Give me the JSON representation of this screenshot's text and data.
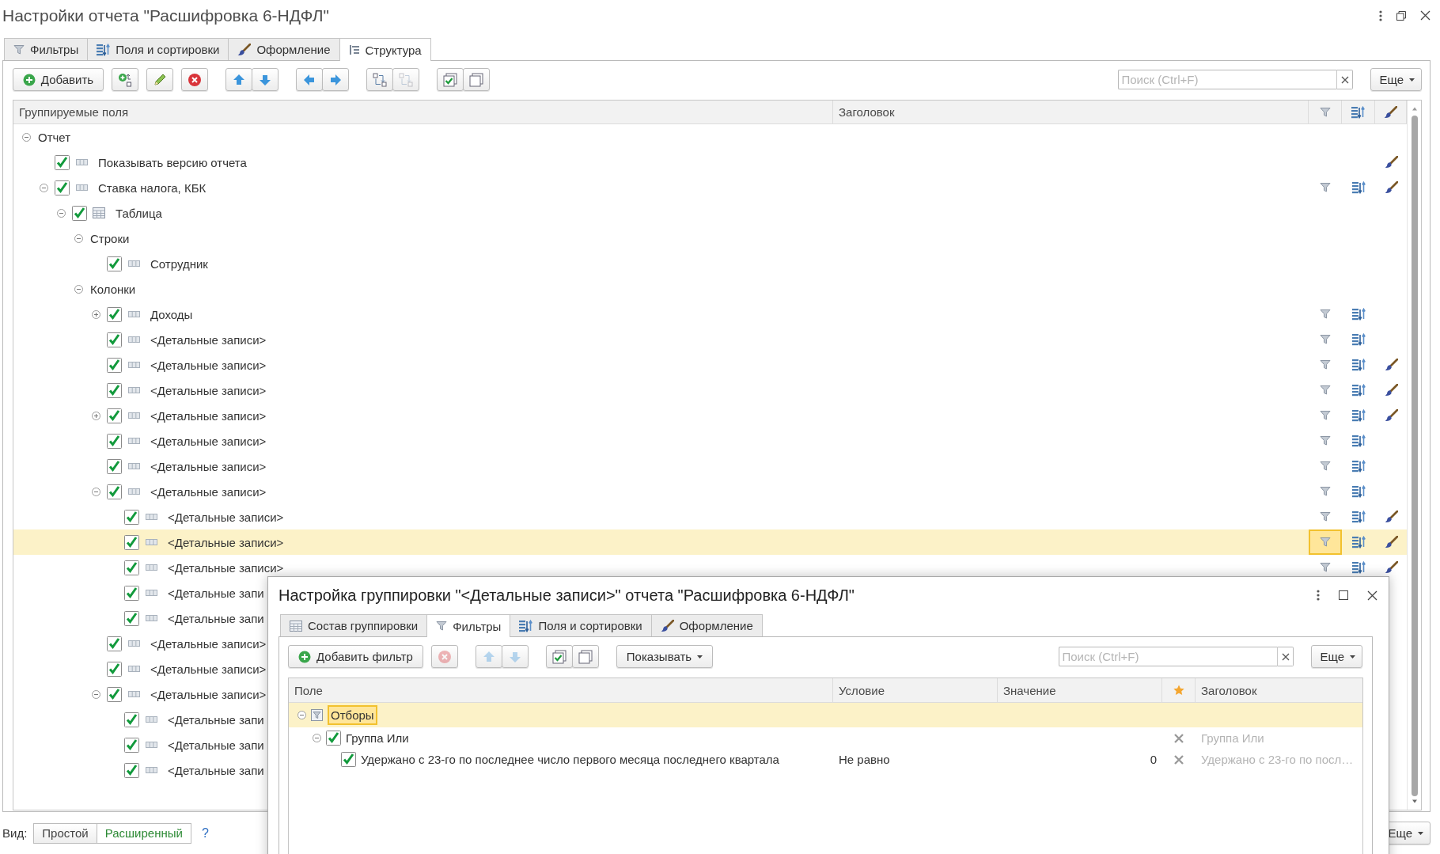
{
  "window": {
    "title": "Настройки отчета \"Расшифровка 6-НДФЛ\""
  },
  "tabs": [
    {
      "label": "Фильтры",
      "kind": "filter",
      "selected": false
    },
    {
      "label": "Поля и сортировки",
      "kind": "sort",
      "selected": false
    },
    {
      "label": "Оформление",
      "kind": "brush",
      "selected": false
    },
    {
      "label": "Структура",
      "kind": "tree",
      "selected": true
    }
  ],
  "toolbar": {
    "add_button": "Добавить",
    "button_groups": [
      {
        "buttons": [
          {
            "kind": "add-group",
            "disabled": false
          }
        ]
      },
      {
        "buttons": [
          {
            "kind": "edit",
            "disabled": false
          }
        ]
      },
      {
        "buttons": [
          {
            "kind": "delete",
            "disabled": false
          }
        ]
      },
      {
        "buttons": [
          {
            "kind": "up",
            "disabled": false
          },
          {
            "kind": "down",
            "disabled": false
          }
        ]
      },
      {
        "buttons": [
          {
            "kind": "left",
            "disabled": false
          },
          {
            "kind": "right",
            "disabled": false
          }
        ]
      },
      {
        "buttons": [
          {
            "kind": "swap",
            "disabled": false
          },
          {
            "kind": "swap",
            "disabled": true
          }
        ]
      },
      {
        "buttons": [
          {
            "kind": "check-all",
            "disabled": false
          },
          {
            "kind": "uncheck-all",
            "disabled": false
          }
        ]
      }
    ],
    "search": {
      "placeholder": "Поиск (Ctrl+F)"
    },
    "more_button": "Еще"
  },
  "tree": {
    "columns": [
      "Группируемые поля",
      "Заголовок"
    ],
    "rows": [
      {
        "label": "Отчет",
        "kind": "section",
        "expanded": true,
        "selected": false,
        "children": [
          {
            "label": "Показывать версию отчета",
            "kind": "field",
            "checked": true,
            "selected": false,
            "style": true
          },
          {
            "label": "Ставка налога, КБК",
            "kind": "field",
            "checked": true,
            "expanded": true,
            "selected": false,
            "filter": true,
            "sort": true,
            "style": true,
            "children": [
              {
                "label": "Таблица",
                "kind": "table",
                "checked": true,
                "expanded": true,
                "selected": false,
                "children": [
                  {
                    "label": "Строки",
                    "kind": "section",
                    "expanded": true,
                    "selected": false,
                    "children": [
                      {
                        "label": "Сотрудник",
                        "kind": "field",
                        "checked": true,
                        "selected": false
                      }
                    ]
                  },
                  {
                    "label": "Колонки",
                    "kind": "section",
                    "expanded": true,
                    "selected": false,
                    "children": [
                      {
                        "label": "Доходы",
                        "kind": "field",
                        "checked": true,
                        "expanded": false,
                        "selected": false,
                        "filter": true,
                        "sort": true
                      },
                      {
                        "label": "<Детальные записи>",
                        "kind": "field",
                        "checked": true,
                        "selected": false,
                        "filter": true,
                        "sort": true
                      },
                      {
                        "label": "<Детальные записи>",
                        "kind": "field",
                        "checked": true,
                        "selected": false,
                        "filter": true,
                        "sort": true,
                        "style": true
                      },
                      {
                        "label": "<Детальные записи>",
                        "kind": "field",
                        "checked": true,
                        "selected": false,
                        "filter": true,
                        "sort": true,
                        "style": true
                      },
                      {
                        "label": "<Детальные записи>",
                        "kind": "field",
                        "checked": true,
                        "expanded": false,
                        "selected": false,
                        "filter": true,
                        "sort": true,
                        "style": true
                      },
                      {
                        "label": "<Детальные записи>",
                        "kind": "field",
                        "checked": true,
                        "selected": false,
                        "filter": true,
                        "sort": true
                      },
                      {
                        "label": "<Детальные записи>",
                        "kind": "field",
                        "checked": true,
                        "selected": false,
                        "filter": true,
                        "sort": true
                      },
                      {
                        "label": "<Детальные записи>",
                        "kind": "field",
                        "checked": true,
                        "expanded": true,
                        "selected": false,
                        "filter": true,
                        "sort": true,
                        "children": [
                          {
                            "label": "<Детальные записи>",
                            "kind": "field",
                            "checked": true,
                            "selected": false,
                            "filter": true,
                            "sort": true,
                            "style": true
                          },
                          {
                            "label": "<Детальные записи>",
                            "kind": "field",
                            "checked": true,
                            "selected": true,
                            "filter": true,
                            "sort": true,
                            "style": true
                          },
                          {
                            "label": "<Детальные записи>",
                            "kind": "field",
                            "checked": true,
                            "selected": false,
                            "filter": true,
                            "sort": true,
                            "style": true
                          },
                          {
                            "label": "<Детальные запи",
                            "kind": "field",
                            "checked": true,
                            "selected": false
                          },
                          {
                            "label": "<Детальные запи",
                            "kind": "field",
                            "checked": true,
                            "selected": false
                          }
                        ]
                      },
                      {
                        "label": "<Детальные записи>",
                        "kind": "field",
                        "checked": true,
                        "selected": false
                      },
                      {
                        "label": "<Детальные записи>",
                        "kind": "field",
                        "checked": true,
                        "selected": false
                      },
                      {
                        "label": "<Детальные записи>",
                        "kind": "field",
                        "checked": true,
                        "expanded": true,
                        "selected": false,
                        "children": [
                          {
                            "label": "<Детальные запи",
                            "kind": "field",
                            "checked": true,
                            "selected": false
                          },
                          {
                            "label": "<Детальные запи",
                            "kind": "field",
                            "checked": true,
                            "selected": false
                          },
                          {
                            "label": "<Детальные запи",
                            "kind": "field",
                            "checked": true,
                            "selected": false
                          }
                        ]
                      }
                    ]
                  }
                ]
              }
            ]
          }
        ]
      }
    ]
  },
  "view_switch": {
    "label": "Вид:",
    "options": [
      {
        "label": "Простой",
        "selected": false
      },
      {
        "label": "Расширенный",
        "selected": true
      }
    ],
    "help": "?"
  },
  "bottom_more_button": "Еще",
  "dialog": {
    "title": "Настройка группировки \"<Детальные записи>\" отчета \"Расшифровка 6-НДФЛ\"",
    "tabs": [
      {
        "label": "Состав группировки",
        "kind": "table",
        "selected": false
      },
      {
        "label": "Фильтры",
        "kind": "filter",
        "selected": true
      },
      {
        "label": "Поля и сортировки",
        "kind": "sort",
        "selected": false
      },
      {
        "label": "Оформление",
        "kind": "brush",
        "selected": false
      }
    ],
    "toolbar": {
      "add_button": "Добавить фильтр",
      "button_groups": [
        {
          "buttons": [
            {
              "kind": "delete",
              "disabled": true
            }
          ]
        },
        {
          "buttons": [
            {
              "kind": "up",
              "disabled": true
            },
            {
              "kind": "down",
              "disabled": true
            }
          ]
        },
        {
          "buttons": [
            {
              "kind": "check-all",
              "disabled": false
            },
            {
              "kind": "uncheck-all",
              "disabled": false
            }
          ]
        }
      ],
      "show_button": "Показывать",
      "search": {
        "placeholder": "Поиск (Ctrl+F)"
      },
      "more_button": "Еще"
    },
    "columns": [
      "Поле",
      "Условие",
      "Значение",
      "Заголовок"
    ],
    "rows": [
      {
        "label": "Отборы",
        "kind": "root",
        "expanded": true,
        "selected": true,
        "children": [
          {
            "label": "Группа Или",
            "kind": "group",
            "checked": true,
            "expanded": true,
            "selected": false,
            "title": "Группа Или",
            "children": [
              {
                "label": "Удержано с 23-го по последнее число первого месяца последнего квартала",
                "kind": "condition",
                "checked": true,
                "selected": false,
                "condition": "Не равно",
                "value": "0",
                "title": "Удержано с 23-го по посл…"
              }
            ]
          }
        ]
      }
    ]
  }
}
